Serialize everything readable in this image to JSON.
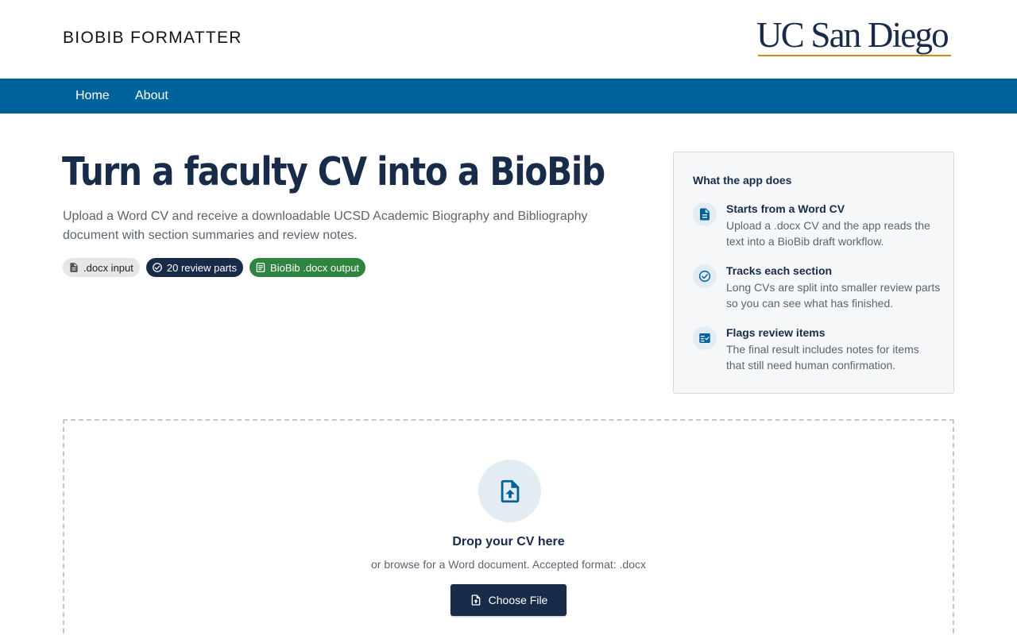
{
  "header": {
    "app_title": "BIOBIB FORMATTER",
    "logo_text": "UC San Diego"
  },
  "nav": {
    "items": [
      {
        "label": "Home"
      },
      {
        "label": "About"
      }
    ]
  },
  "hero": {
    "title": "Turn a faculty CV into a BioBib",
    "description": "Upload a Word CV and receive a downloadable UCSD Academic Biography and Bibliography document with section summaries and review notes.",
    "chips": [
      {
        "label": ".docx input",
        "icon": "document-icon"
      },
      {
        "label": "20 review parts",
        "icon": "check-circle-icon"
      },
      {
        "label": "BioBib .docx output",
        "icon": "article-icon"
      }
    ]
  },
  "info_card": {
    "title": "What the app does",
    "features": [
      {
        "title": "Starts from a Word CV",
        "description": "Upload a .docx CV and the app reads the text into a BioBib draft workflow.",
        "icon": "document-icon"
      },
      {
        "title": "Tracks each section",
        "description": "Long CVs are split into smaller review parts so you can see what has finished.",
        "icon": "check-circle-icon"
      },
      {
        "title": "Flags review items",
        "description": "The final result includes notes for items that still need human confirmation.",
        "icon": "checklist-icon"
      }
    ]
  },
  "dropzone": {
    "title": "Drop your CV here",
    "subtitle": "or browse for a Word document. Accepted format: .docx",
    "button_label": "Choose File",
    "icon": "file-upload-icon"
  },
  "colors": {
    "navy": "#182b49",
    "blue": "#00629b",
    "gold": "#c69214",
    "green": "#2e8540"
  }
}
